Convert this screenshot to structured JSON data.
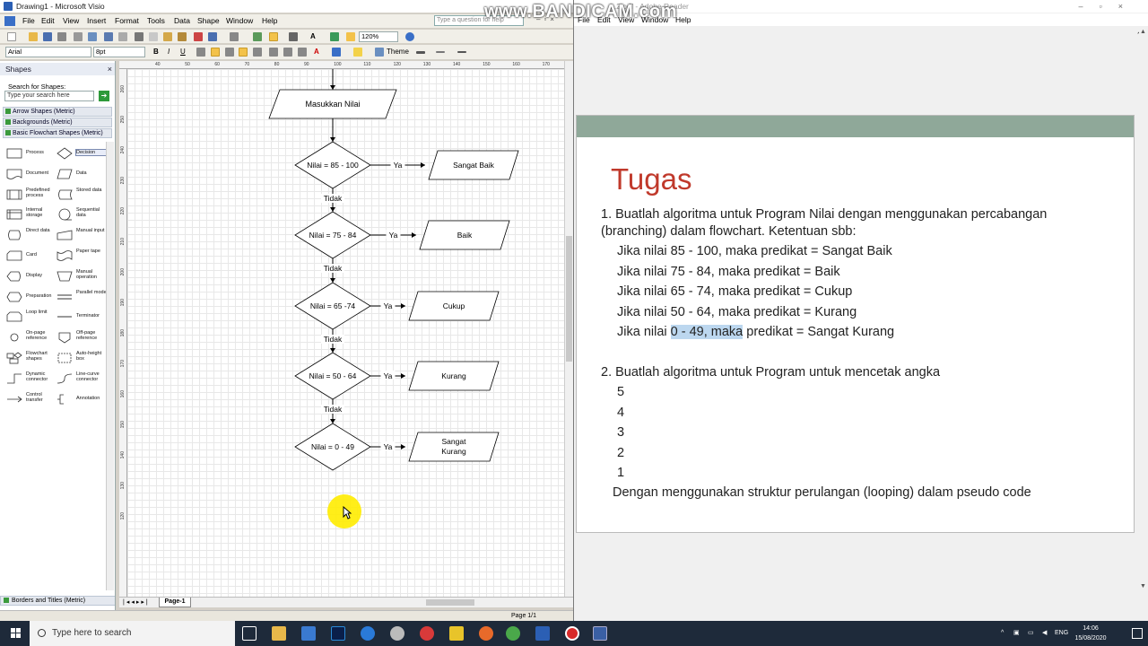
{
  "visio": {
    "title": "Drawing1 - Microsoft Visio",
    "menu": [
      "File",
      "Edit",
      "View",
      "Insert",
      "Format",
      "Tools",
      "Data",
      "Shape",
      "Window",
      "Help"
    ],
    "help_placeholder": "Type a question for help",
    "zoom": "120%",
    "font": "Arial",
    "font_size": "8pt",
    "theme_label": "Theme",
    "shapes_panel": {
      "title": "Shapes",
      "search_label": "Search for Shapes:",
      "search_placeholder": "Type your search here",
      "stencils": [
        "Arrow Shapes (Metric)",
        "Backgrounds (Metric)",
        "Basic Flowchart Shapes (Metric)"
      ],
      "items": [
        {
          "label": "Process",
          "icon": "process-icon"
        },
        {
          "label": "Decision",
          "icon": "decision-icon"
        },
        {
          "label": "Document",
          "icon": "document-icon"
        },
        {
          "label": "Data",
          "icon": "data-icon"
        },
        {
          "label": "Predefined process",
          "icon": "predefined-process-icon"
        },
        {
          "label": "Stored data",
          "icon": "stored-data-icon"
        },
        {
          "label": "Internal storage",
          "icon": "internal-storage-icon"
        },
        {
          "label": "Sequential data",
          "icon": "sequential-data-icon"
        },
        {
          "label": "Direct data",
          "icon": "direct-data-icon"
        },
        {
          "label": "Manual input",
          "icon": "manual-input-icon"
        },
        {
          "label": "Card",
          "icon": "card-icon"
        },
        {
          "label": "Paper tape",
          "icon": "paper-tape-icon"
        },
        {
          "label": "Display",
          "icon": "display-icon"
        },
        {
          "label": "Manual operation",
          "icon": "manual-operation-icon"
        },
        {
          "label": "Preparation",
          "icon": "preparation-icon"
        },
        {
          "label": "Parallel mode",
          "icon": "parallel-mode-icon"
        },
        {
          "label": "Loop limit",
          "icon": "loop-limit-icon"
        },
        {
          "label": "Terminator",
          "icon": "terminator-icon"
        },
        {
          "label": "On-page reference",
          "icon": "on-page-reference-icon"
        },
        {
          "label": "Off-page reference",
          "icon": "off-page-reference-icon"
        },
        {
          "label": "Flowchart shapes",
          "icon": "flowchart-shapes-icon"
        },
        {
          "label": "Auto-height box",
          "icon": "auto-height-box-icon"
        },
        {
          "label": "Dynamic connector",
          "icon": "dynamic-connector-icon"
        },
        {
          "label": "Line-curve connector",
          "icon": "line-curve-connector-icon"
        },
        {
          "label": "Control transfer",
          "icon": "control-transfer-icon"
        },
        {
          "label": "Annotation",
          "icon": "annotation-icon"
        }
      ],
      "footer_stencil": "Borders and Titles (Metric)"
    },
    "ruler_top": [
      "40",
      "50",
      "60",
      "70",
      "80",
      "90",
      "100",
      "110",
      "120",
      "130",
      "140",
      "150",
      "160",
      "170"
    ],
    "ruler_left": [
      "260",
      "250",
      "240",
      "230",
      "220",
      "210",
      "200",
      "190",
      "180",
      "170",
      "160",
      "150",
      "140",
      "130",
      "120"
    ],
    "flowchart": {
      "input": "Masukkan Nilai",
      "yes_label": "Ya",
      "no_label": "Tidak",
      "decisions": [
        {
          "cond": "Nilai = 85 - 100",
          "result": "Sangat Baik"
        },
        {
          "cond": "Nilai = 75 - 84",
          "result": "Baik"
        },
        {
          "cond": "Nilai = 65 -74",
          "result": "Cukup"
        },
        {
          "cond": "Nilai = 50 - 64",
          "result": "Kurang"
        },
        {
          "cond": "Nilai = 0 - 49",
          "result": "Sangat Kurang"
        }
      ]
    },
    "page_tab": "Page-1",
    "status_page": "Page 1/1"
  },
  "watermark": "www.BANDICAM.com",
  "reader": {
    "title": "...2.pdf - Adobe Reader",
    "menu": [
      "File",
      "Edit",
      "View",
      "Window",
      "Help"
    ],
    "heading": "Tugas",
    "q1_line1": "1. Buatlah algoritma untuk Program Nilai dengan menggunakan percabangan",
    "q1_line2": "(branching) dalam flowchart. Ketentuan sbb:",
    "rules": [
      "Jika nilai 85 - 100, maka predikat = Sangat Baik",
      "Jika nilai 75 - 84, maka predikat = Baik",
      "Jika nilai 65 - 74, maka predikat = Cukup",
      "Jika nilai 50 - 64, maka predikat = Kurang"
    ],
    "rule5_pre": "Jika nilai ",
    "rule5_hl": "0 - 49, maka",
    "rule5_post": " predikat = Sangat Kurang",
    "q2": "2. Buatlah algoritma untuk Program untuk mencetak angka",
    "numbers": [
      "5",
      "4",
      "3",
      "2",
      "1"
    ],
    "q2_footer": "Dengan menggunakan struktur perulangan (looping) dalam pseudo code"
  },
  "taskbar": {
    "search_placeholder": "Type here to search",
    "lang": "ENG",
    "time": "14:06",
    "date": "15/08/2020"
  }
}
